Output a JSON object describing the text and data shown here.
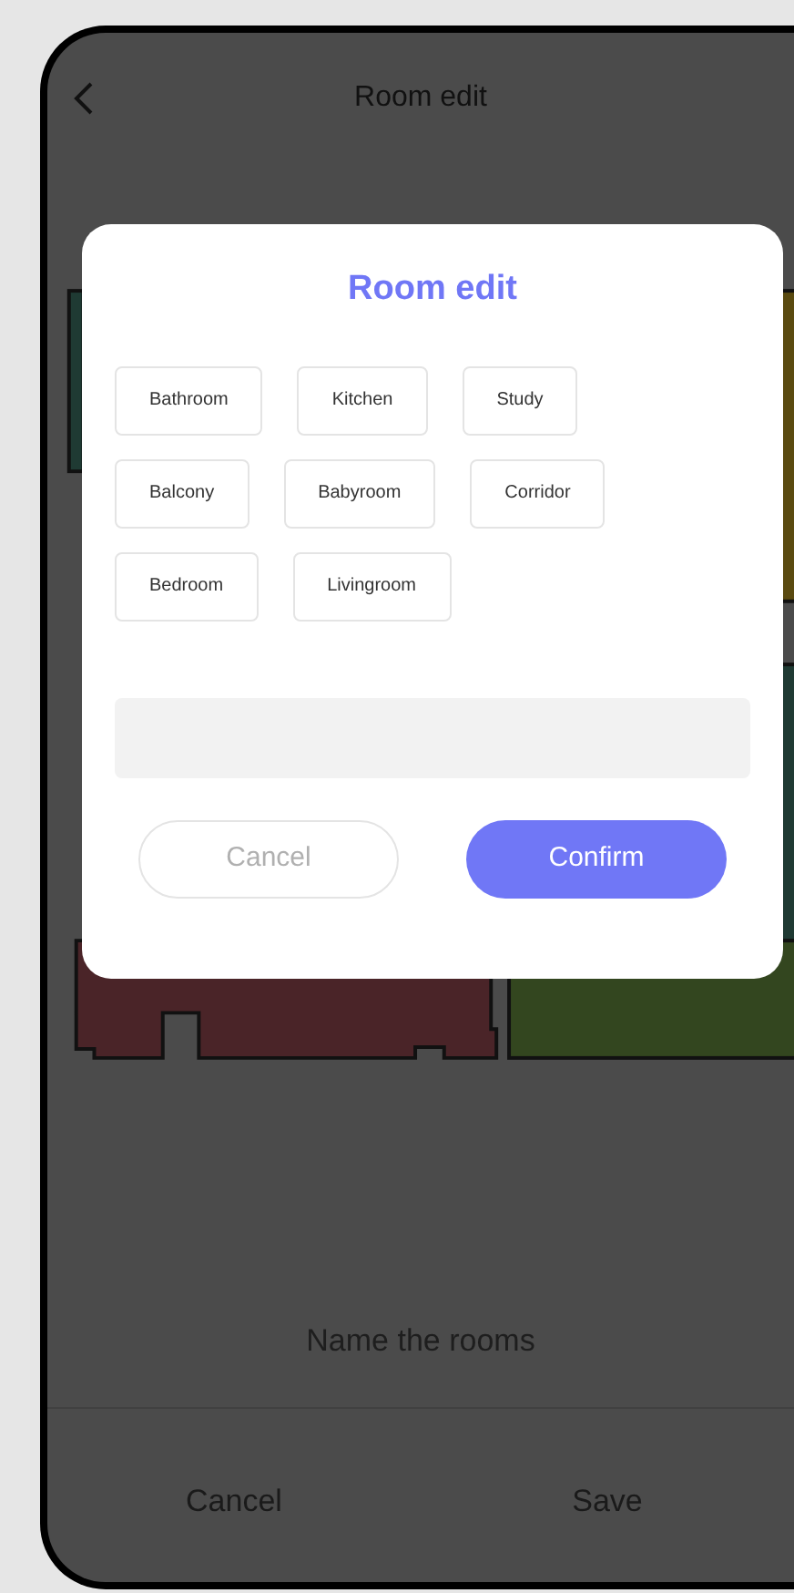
{
  "header": {
    "title": "Room edit"
  },
  "dialog": {
    "title": "Room edit",
    "room_options": [
      {
        "label": "Bathroom",
        "selected": false
      },
      {
        "label": "Kitchen",
        "selected": false
      },
      {
        "label": "Study",
        "selected": false
      },
      {
        "label": "Balcony",
        "selected": false
      },
      {
        "label": "Babyroom",
        "selected": false
      },
      {
        "label": "Corridor",
        "selected": false
      },
      {
        "label": "Bedroom",
        "selected": false
      },
      {
        "label": "Livingroom",
        "selected": false
      }
    ],
    "buttons": [
      {
        "label": "Cancel",
        "kind": "secondary"
      },
      {
        "label": "Confirm",
        "kind": "primary"
      }
    ]
  },
  "hint": "Name the rooms",
  "footer_buttons": [
    "Cancel",
    "Save"
  ]
}
